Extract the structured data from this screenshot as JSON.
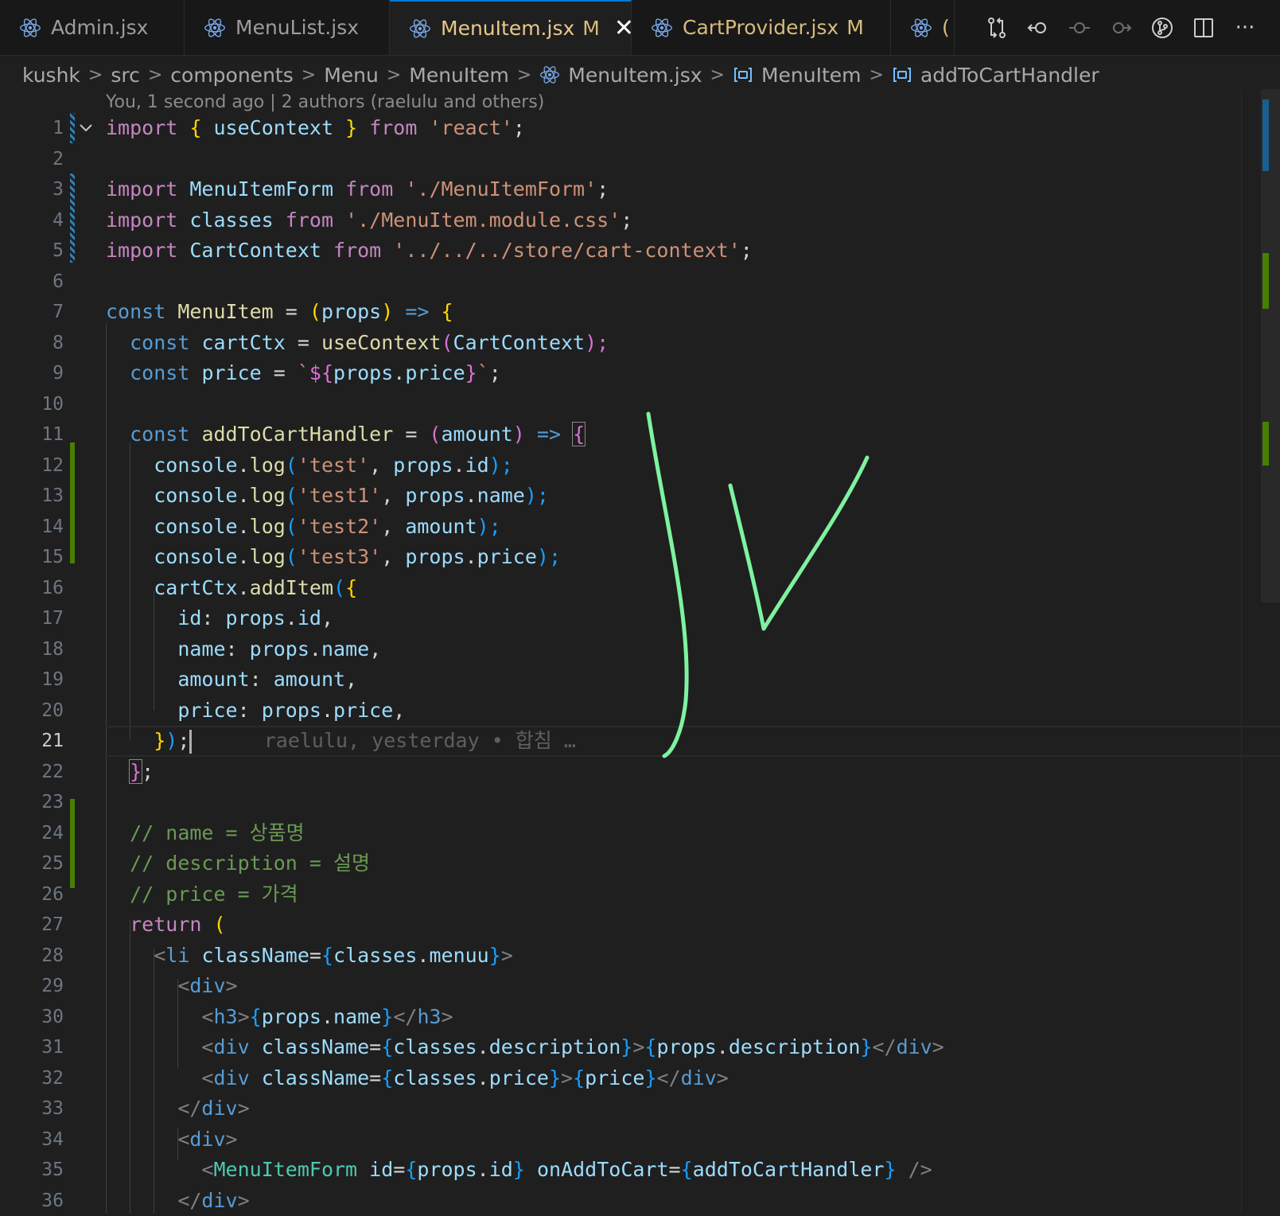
{
  "tabs": [
    {
      "label": "Admin.jsx",
      "modified": ""
    },
    {
      "label": "MenuList.jsx",
      "modified": ""
    },
    {
      "label": "MenuItem.jsx",
      "modified": "M",
      "close": "✕"
    },
    {
      "label": "CartProvider.jsx",
      "modified": "M"
    },
    {
      "label": "(",
      "modified": ""
    }
  ],
  "breadcrumb": {
    "items": [
      "kushk",
      "src",
      "components",
      "Menu",
      "MenuItem",
      "MenuItem.jsx",
      "MenuItem",
      "addToCartHandler"
    ]
  },
  "blame_header": "You, 1 second ago | 2 authors (raelulu and others)",
  "line_numbers": [
    "1",
    "2",
    "3",
    "4",
    "5",
    "6",
    "7",
    "8",
    "9",
    "10",
    "11",
    "12",
    "13",
    "14",
    "15",
    "16",
    "17",
    "18",
    "19",
    "20",
    "21",
    "22",
    "23",
    "24",
    "25",
    "26",
    "27",
    "28",
    "29",
    "30",
    "31",
    "32",
    "33",
    "34",
    "35",
    "36"
  ],
  "current_line": "21",
  "inline_blame": "raelulu, yesterday • 합침 …",
  "code": {
    "l1": [
      "import",
      "{",
      " useContext ",
      "}",
      "from",
      "'react'",
      ";"
    ],
    "l3": [
      "import",
      "MenuItemForm",
      "from",
      "'./MenuItemForm'",
      ";"
    ],
    "l4": [
      "import",
      "classes",
      "from",
      "'./MenuItem.module.css'",
      ";"
    ],
    "l5": [
      "import",
      "CartContext",
      "from",
      "'../../../store/cart-context'",
      ";"
    ],
    "l7": [
      "const",
      "MenuItem",
      " = ",
      "(",
      "props",
      ")",
      " => ",
      "{"
    ],
    "l8": [
      "const",
      "cartCtx",
      " = ",
      "useContext",
      "(",
      "CartContext",
      ");"
    ],
    "l9": [
      "const",
      "price",
      " = ",
      "`",
      "${",
      "props",
      ".",
      "price",
      "}",
      "`",
      ";"
    ],
    "l11": [
      "const",
      "addToCartHandler",
      " = ",
      "(",
      "amount",
      ")",
      " => ",
      "{"
    ],
    "l12": [
      "console",
      ".",
      "log",
      "(",
      "'test'",
      ", ",
      "props",
      ".",
      "id",
      ");"
    ],
    "l13": [
      "console",
      ".",
      "log",
      "(",
      "'test1'",
      ", ",
      "props",
      ".",
      "name",
      ");"
    ],
    "l14": [
      "console",
      ".",
      "log",
      "(",
      "'test2'",
      ", ",
      "amount",
      ");"
    ],
    "l15": [
      "console",
      ".",
      "log",
      "(",
      "'test3'",
      ", ",
      "props",
      ".",
      "price",
      ");"
    ],
    "l16": [
      "cartCtx",
      ".",
      "addItem",
      "(",
      "{"
    ],
    "l17": [
      "id",
      ": ",
      "props",
      ".",
      "id",
      ","
    ],
    "l18": [
      "name",
      ": ",
      "props",
      ".",
      "name",
      ","
    ],
    "l19": [
      "amount",
      ": ",
      "amount",
      ","
    ],
    "l20": [
      "price",
      ": ",
      "props",
      ".",
      "price",
      ","
    ],
    "l21": [
      "}",
      ")",
      ";"
    ],
    "l22": [
      "}",
      ";"
    ],
    "l24": "// name = 상품명",
    "l25": "// description = 설명",
    "l26": "// price = 가격",
    "l27": [
      "return",
      "("
    ],
    "l28": [
      "<",
      "li",
      "className",
      "=",
      "{",
      "classes",
      ".",
      "menuu",
      "}",
      ">"
    ],
    "l29": [
      "<",
      "div",
      ">"
    ],
    "l30": [
      "<",
      "h3",
      ">",
      "{",
      "props",
      ".",
      "name",
      "}",
      "</",
      "h3",
      ">"
    ],
    "l31": [
      "<",
      "div",
      "className",
      "=",
      "{",
      "classes",
      ".",
      "description",
      "}",
      ">",
      "{",
      "props",
      ".",
      "description",
      "}",
      "</",
      "div",
      ">"
    ],
    "l32": [
      "<",
      "div",
      "className",
      "=",
      "{",
      "classes",
      ".",
      "price",
      "}",
      ">",
      "{",
      "price",
      "}",
      "</",
      "div",
      ">"
    ],
    "l33": [
      "</",
      "div",
      ">"
    ],
    "l34": [
      "<",
      "div",
      ">"
    ],
    "l35": [
      "<",
      "MenuItemForm",
      "id",
      "=",
      "{",
      "props",
      ".",
      "id",
      "}",
      "onAddToCart",
      "=",
      "{",
      "addToCartHandler",
      "}",
      "/>"
    ],
    "l36": [
      "</",
      "div",
      ">"
    ]
  },
  "icons": {
    "file": "react-icon",
    "actions": [
      "compare-changes-icon",
      "go-back-icon",
      "commit-icon",
      "go-forward-icon",
      "source-control-icon",
      "split-editor-icon",
      "more-actions-icon"
    ],
    "more": "···"
  },
  "colors": {
    "background": "#1f1f1f",
    "keyword": "#c586c0",
    "storage": "#569cd6",
    "variable": "#9cdcfe",
    "function": "#dcdcaa",
    "string": "#ce9178",
    "comment": "#6a9955",
    "annotation": "#7ef2a0"
  }
}
